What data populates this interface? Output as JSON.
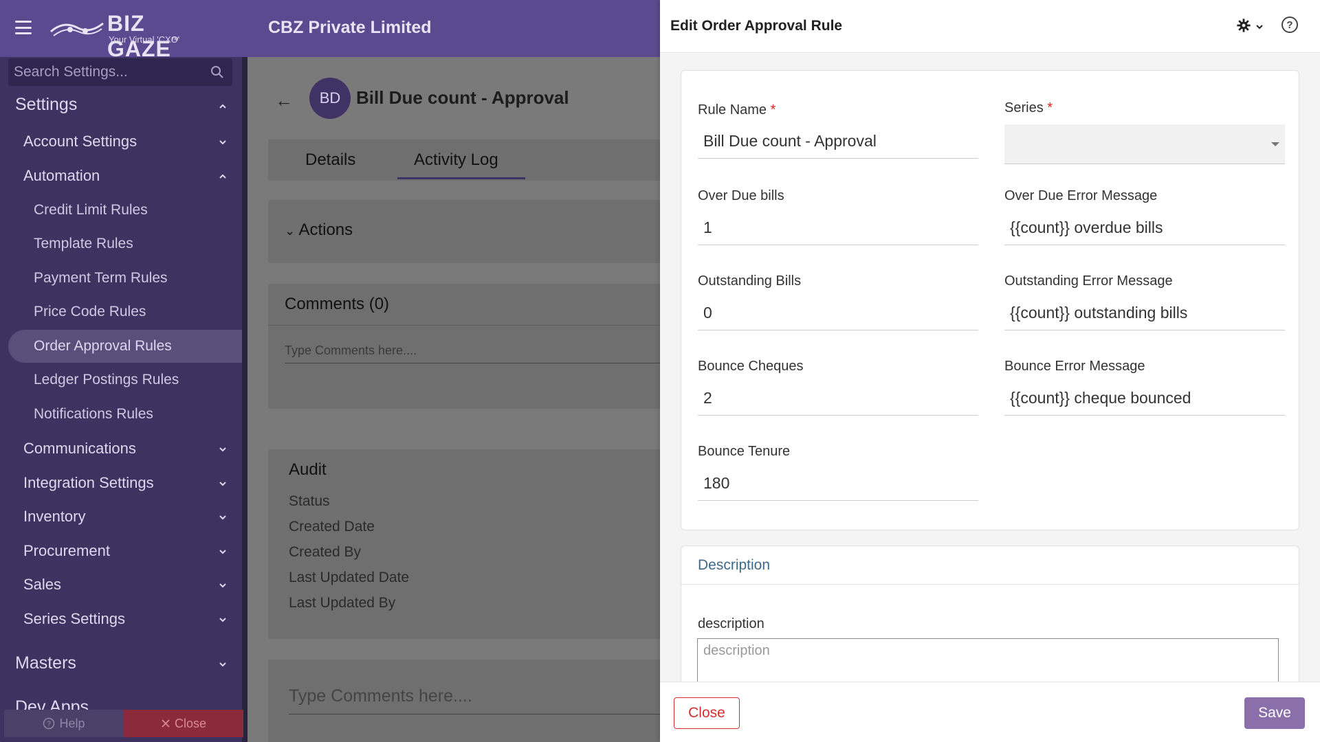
{
  "header": {
    "logo_name": "BIZ GAZE",
    "logo_tm": "™",
    "logo_tagline": "Your Virtual 'CXO'",
    "company": "CBZ Private Limited"
  },
  "sidebar": {
    "search_placeholder": "Search Settings...",
    "settings_label": "Settings",
    "account_settings": "Account Settings",
    "automation": "Automation",
    "automation_items": [
      "Credit Limit Rules",
      "Template Rules",
      "Payment Term Rules",
      "Price Code Rules",
      "Order Approval Rules",
      "Ledger Postings Rules",
      "Notifications Rules"
    ],
    "communications": "Communications",
    "integration_settings": "Integration Settings",
    "inventory": "Inventory",
    "procurement": "Procurement",
    "sales": "Sales",
    "series_settings": "Series Settings",
    "masters": "Masters",
    "dev_apps": "Dev Apps",
    "help_label": "Help",
    "close_label": "Close"
  },
  "main": {
    "avatar_initials": "BD",
    "record_title": "Bill Due count - Approval",
    "tabs": [
      "Details",
      "Activity Log"
    ],
    "actions_label": "Actions",
    "comments_title": "Comments (0)",
    "comments_placeholder": "Type Comments here....",
    "audit_title": "Audit",
    "audit_rows": [
      "Status",
      "Created Date",
      "Created By",
      "Last Updated Date",
      "Last Updated By"
    ],
    "bottom_comment_placeholder": "Type Comments here...."
  },
  "panel": {
    "title": "Edit Order Approval Rule",
    "fields": {
      "rule_name_label": "Rule Name",
      "rule_name_value": "Bill Due count - Approval",
      "series_label": "Series",
      "series_value": "",
      "over_due_bills_label": "Over Due bills",
      "over_due_bills_value": "1",
      "over_due_error_label": "Over Due Error Message",
      "over_due_error_value": "{{count}} overdue bills",
      "outstanding_bills_label": "Outstanding Bills",
      "outstanding_bills_value": "0",
      "outstanding_error_label": "Outstanding Error Message",
      "outstanding_error_value": "{{count}} outstanding bills",
      "bounce_cheques_label": "Bounce Cheques",
      "bounce_cheques_value": "2",
      "bounce_error_label": "Bounce Error Message",
      "bounce_error_value": "{{count}} cheque bounced",
      "bounce_tenure_label": "Bounce Tenure",
      "bounce_tenure_value": "180"
    },
    "required_marker": "*",
    "description_section": "Description",
    "description_label": "description",
    "description_placeholder": "description",
    "close_button": "Close",
    "save_button": "Save"
  },
  "colors": {
    "header_bg": "#5b4a8f",
    "sidebar_bg": "#3e3360",
    "save_bg": "#8b6fab",
    "close_red": "#d32f2f"
  }
}
